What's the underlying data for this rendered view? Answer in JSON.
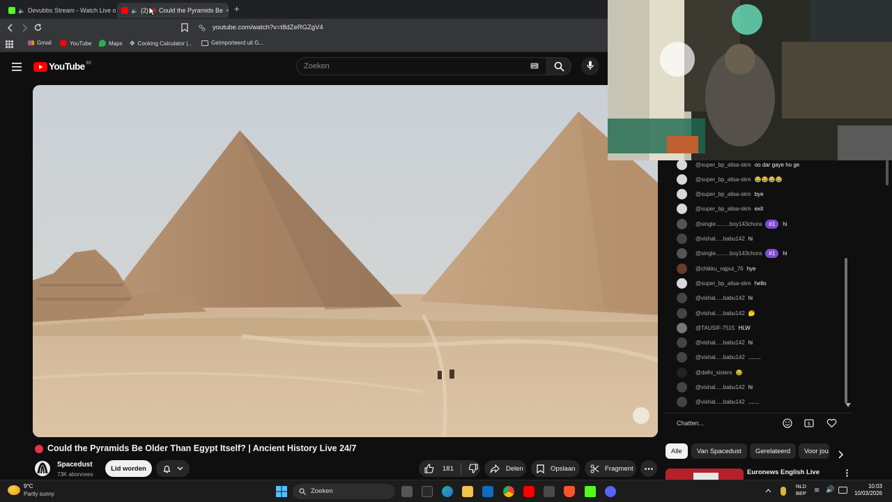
{
  "browser": {
    "tabs": [
      {
        "label": "Devubbs Stream - Watch Live on",
        "active": false
      },
      {
        "label": "(2)",
        "title": "Could the Pyramids Be",
        "active": true
      }
    ],
    "new_tab": "+",
    "url": "youtube.com/watch?v=t8dZeRGZgV4",
    "bookmarks": [
      "Gmail",
      "YouTube",
      "Maps",
      "Cooking Calculator |...",
      "Geïmporteerd uit G..."
    ]
  },
  "youtube": {
    "logo": "YouTube",
    "region": "BE",
    "search_placeholder": "Zoeken"
  },
  "video": {
    "title": "Could the Pyramids Be Older Than Egypt Itself? | Ancient History Live 24/7",
    "channel": "Spacedust",
    "subscribers": "73K abonnees",
    "join_label": "Lid worden",
    "likes": "181",
    "share_label": "Delen",
    "save_label": "Opslaan",
    "clip_label": "Fragment"
  },
  "chat": {
    "messages": [
      {
        "author": "@super_bp_alisa-skm",
        "text": "oo dar gaye ho ge",
        "badge": "",
        "color": "#d8d8d8"
      },
      {
        "author": "@super_bp_alisa-skm",
        "text": "😂😂😂😂",
        "badge": "",
        "color": "#d8d8d8"
      },
      {
        "author": "@super_bp_alisa-skm",
        "text": "bye",
        "badge": "",
        "color": "#d8d8d8"
      },
      {
        "author": "@super_bp_alisa-skm",
        "text": "exit",
        "badge": "",
        "color": "#d8d8d8"
      },
      {
        "author": "@single.........boy143chora",
        "text": "hi",
        "badge": "#1",
        "color": "#555"
      },
      {
        "author": "@vishal.....babu142",
        "text": "hi",
        "badge": "",
        "color": "#444"
      },
      {
        "author": "@single.........boy143chora",
        "text": "hi",
        "badge": "#1",
        "color": "#555"
      },
      {
        "author": "@chikku_rajput_76",
        "text": "hye",
        "badge": "",
        "color": "#6a3a2a"
      },
      {
        "author": "@super_bp_alisa-skm",
        "text": "hello",
        "badge": "",
        "color": "#d8d8d8"
      },
      {
        "author": "@vishal.....babu142",
        "text": "hi",
        "badge": "",
        "color": "#444"
      },
      {
        "author": "@vishal.....babu142",
        "text": "🤔",
        "badge": "",
        "color": "#444"
      },
      {
        "author": "@TAUSIF-7515",
        "text": "HLW",
        "badge": "",
        "color": "#777"
      },
      {
        "author": "@vishal.....babu142",
        "text": "hi",
        "badge": "",
        "color": "#444"
      },
      {
        "author": "@vishal.....babu142",
        "text": "........",
        "badge": "",
        "color": "#444"
      },
      {
        "author": "@delhi_sisters",
        "text": "😂",
        "badge": "",
        "color": "#222"
      },
      {
        "author": "@vishal.....babu142",
        "text": "hi",
        "badge": "",
        "color": "#444"
      },
      {
        "author": "@vishal.....babu142",
        "text": ".......",
        "badge": "",
        "color": "#444"
      }
    ],
    "input_placeholder": "Chatten..."
  },
  "chips": [
    "Alle",
    "Van Spacedust",
    "Gerelateerd",
    "Voor jou"
  ],
  "recommendation": {
    "title": "Euronews English Live"
  },
  "taskbar": {
    "weather_temp": "9°C",
    "weather_desc": "Partly sunny",
    "search_label": "Zoeken",
    "lang_1": "NLD",
    "lang_2": "BEP",
    "time": "10:03",
    "date": "10/03/2026"
  },
  "icons": [
    "menu-icon",
    "search-icon",
    "mic-icon",
    "keyboard-icon",
    "bell-icon",
    "like-icon",
    "dislike-icon",
    "share-icon",
    "save-icon",
    "clip-icon",
    "more-icon",
    "emoji-icon",
    "heart-icon",
    "windows-icon"
  ]
}
